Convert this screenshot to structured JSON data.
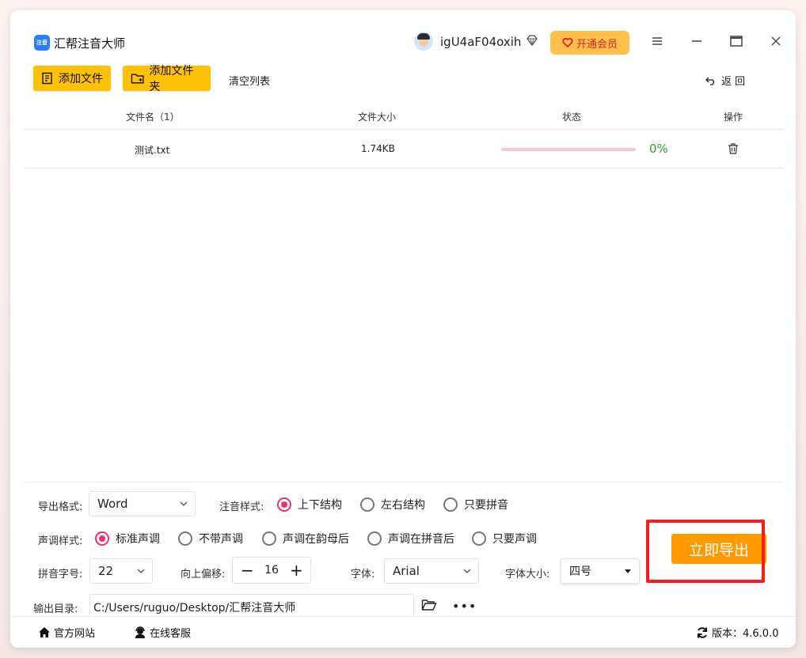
{
  "app": {
    "title": "汇帮注音大师",
    "logo_text": "注音"
  },
  "user": {
    "name": "igU4aF04oxih"
  },
  "vip_button": "开通会员",
  "toolbar": {
    "add_file": "添加文件",
    "add_folder": "添加文件夹",
    "clear": "清空列表",
    "back": "返 回"
  },
  "table": {
    "headers": [
      "文件名（1）",
      "文件大小",
      "状态",
      "操作"
    ],
    "rows": [
      {
        "name": "测试.txt",
        "size": "1.74KB",
        "progress_pct": "0%",
        "progress": 0
      }
    ]
  },
  "settings": {
    "export_format_label": "导出格式:",
    "export_format_value": "Word",
    "pinyin_style_label": "注音样式:",
    "pinyin_style_options": [
      "上下结构",
      "左右结构",
      "只要拼音"
    ],
    "pinyin_style_selected": 0,
    "tone_style_label": "声调样式:",
    "tone_style_options": [
      "标准声调",
      "不带声调",
      "声调在韵母后",
      "声调在拼音后",
      "只要声调"
    ],
    "tone_style_selected": 0,
    "pinyin_size_label": "拼音字号:",
    "pinyin_size_value": "22",
    "offset_label": "向上偏移:",
    "offset_value": "16",
    "font_label": "字体:",
    "font_value": "Arial",
    "font_size_label": "字体大小:",
    "font_size_value": "四号",
    "output_dir_label": "输出目录:",
    "output_dir_value": "C:/Users/ruguo/Desktop/汇帮注音大师",
    "export_button": "立即导出"
  },
  "footer": {
    "site": "官方网站",
    "service": "在线客服",
    "version": "版本：4.6.0.0"
  },
  "colors": {
    "accent": "#ffc107",
    "export": "#ff9a00",
    "radio_on": "#e8336b",
    "highlight": "#ff1a1a"
  }
}
